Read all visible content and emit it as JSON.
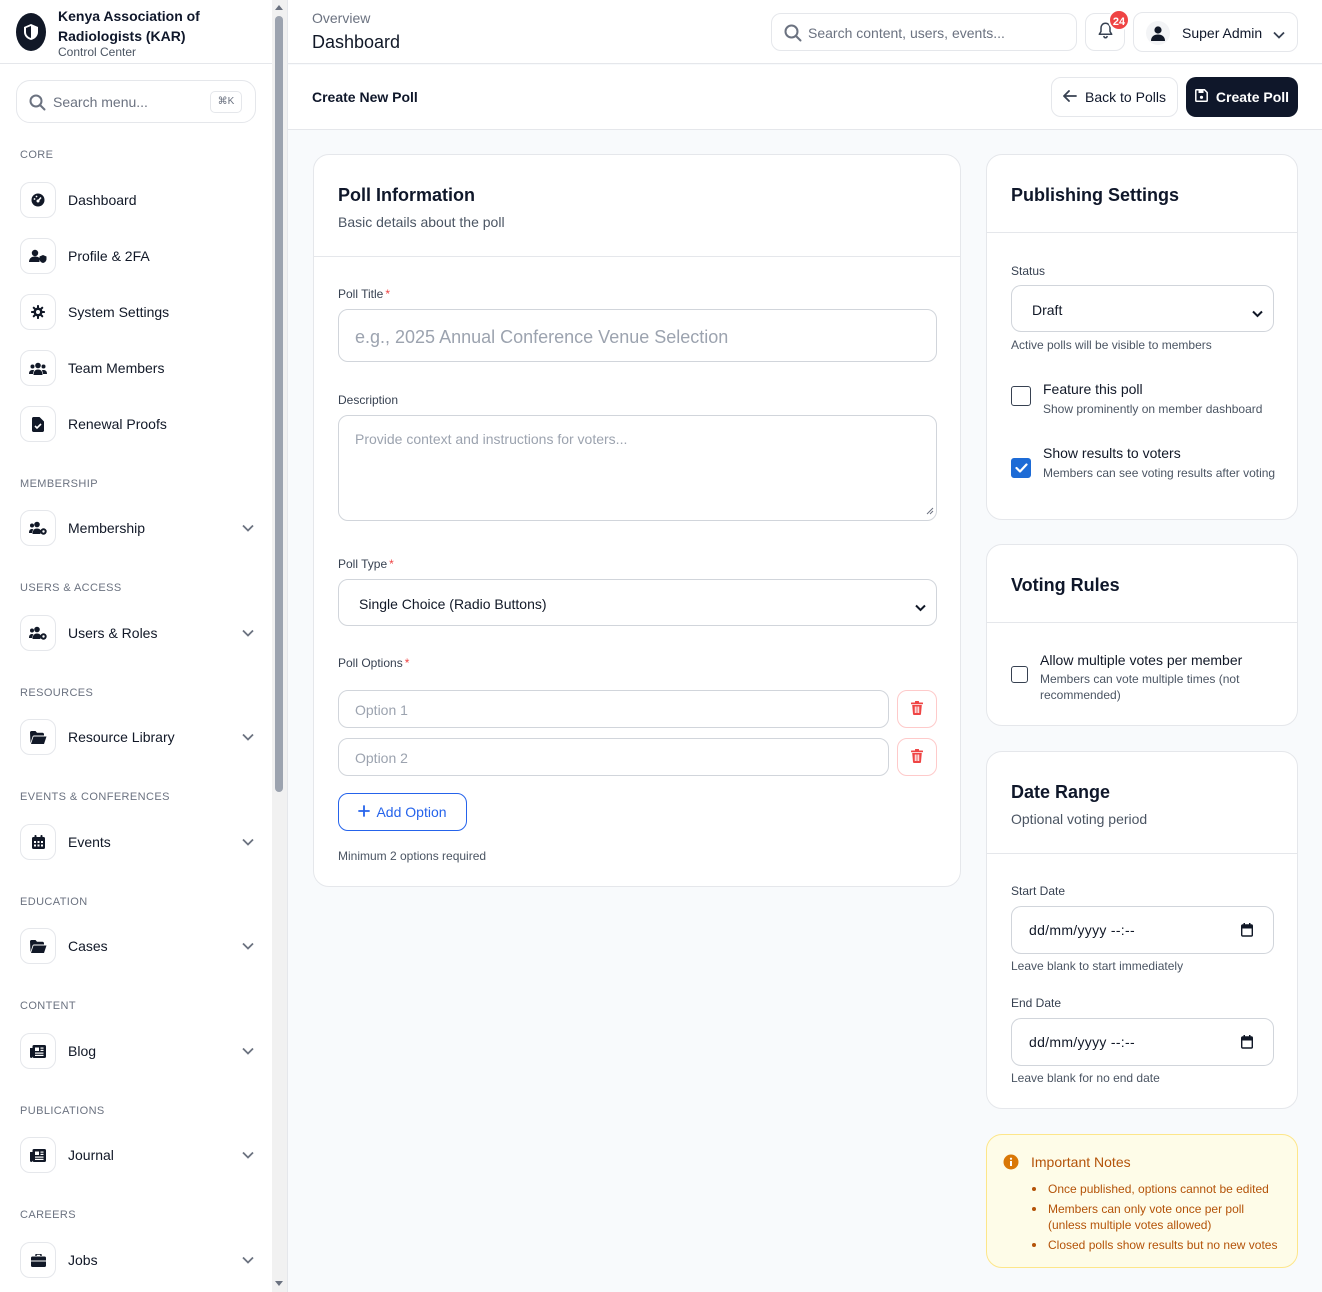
{
  "brand": {
    "name": "Kenya Association of Radiologists (KAR)",
    "subtitle": "Control Center"
  },
  "sidebar": {
    "search_placeholder": "Search menu...",
    "search_shortcut": "⌘K",
    "sections": [
      {
        "label": "CORE",
        "items": [
          {
            "label": "Dashboard",
            "icon": "gauge-icon"
          },
          {
            "label": "Profile & 2FA",
            "icon": "user-shield-icon"
          },
          {
            "label": "System Settings",
            "icon": "gear-icon"
          },
          {
            "label": "Team Members",
            "icon": "users-icon"
          },
          {
            "label": "Renewal Proofs",
            "icon": "file-check-icon"
          }
        ]
      },
      {
        "label": "MEMBERSHIP",
        "items": [
          {
            "label": "Membership",
            "icon": "users-gear-icon"
          }
        ]
      },
      {
        "label": "USERS & ACCESS",
        "items": [
          {
            "label": "Users & Roles",
            "icon": "users-gear-icon"
          }
        ]
      },
      {
        "label": "RESOURCES",
        "items": [
          {
            "label": "Resource Library",
            "icon": "folder-open-icon"
          }
        ]
      },
      {
        "label": "EVENTS & CONFERENCES",
        "items": [
          {
            "label": "Events",
            "icon": "calendar-icon"
          }
        ]
      },
      {
        "label": "EDUCATION",
        "items": [
          {
            "label": "Cases",
            "icon": "folder-open-icon"
          }
        ]
      },
      {
        "label": "CONTENT",
        "items": [
          {
            "label": "Blog",
            "icon": "newspaper-icon"
          }
        ]
      },
      {
        "label": "PUBLICATIONS",
        "items": [
          {
            "label": "Journal",
            "icon": "newspaper-icon"
          }
        ]
      },
      {
        "label": "CAREERS",
        "items": [
          {
            "label": "Jobs",
            "icon": "briefcase-icon"
          }
        ]
      }
    ]
  },
  "header": {
    "breadcrumb": "Overview",
    "title": "Dashboard",
    "search_placeholder": "Search content, users, events...",
    "notifications_count": "24",
    "user_name": "Super Admin"
  },
  "toolbar": {
    "title": "Create New Poll",
    "back_label": "Back to Polls",
    "create_label": "Create Poll"
  },
  "poll_info": {
    "title": "Poll Information",
    "subtitle": "Basic details about the poll",
    "poll_title_label": "Poll Title",
    "poll_title_placeholder": "e.g., 2025 Annual Conference Venue Selection",
    "description_label": "Description",
    "description_placeholder": "Provide context and instructions for voters...",
    "poll_type_label": "Poll Type",
    "poll_type_value": "Single Choice (Radio Buttons)",
    "options_label": "Poll Options",
    "options": [
      {
        "placeholder": "Option 1"
      },
      {
        "placeholder": "Option 2"
      }
    ],
    "add_option_label": "Add Option",
    "options_hint": "Minimum 2 options required",
    "required_mark": "*"
  },
  "publishing": {
    "title": "Publishing Settings",
    "status_label": "Status",
    "status_value": "Draft",
    "status_hint": "Active polls will be visible to members",
    "feature_title": "Feature this poll",
    "feature_desc": "Show prominently on member dashboard",
    "feature_checked": false,
    "show_results_title": "Show results to voters",
    "show_results_desc": "Members can see voting results after voting",
    "show_results_checked": true
  },
  "voting_rules": {
    "title": "Voting Rules",
    "multi_title": "Allow multiple votes per member",
    "multi_desc": "Members can vote multiple times (not recommended)",
    "multi_checked": false
  },
  "date_range": {
    "title": "Date Range",
    "subtitle": "Optional voting period",
    "start_label": "Start Date",
    "start_value": "dd/mm/yyyy --:--",
    "start_hint": "Leave blank to start immediately",
    "end_label": "End Date",
    "end_value": "dd/mm/yyyy --:--",
    "end_hint": "Leave blank for no end date"
  },
  "notes": {
    "title": "Important Notes",
    "items": [
      "Once published, options cannot be edited",
      "Members can only vote once per poll (unless multiple votes allowed)",
      "Closed polls show results but no new votes"
    ]
  },
  "colors": {
    "primary_dark": "#0f172a",
    "accent_blue": "#2563eb",
    "danger": "#ef4444",
    "note_text": "#b45309",
    "note_bg": "#fefce8"
  }
}
